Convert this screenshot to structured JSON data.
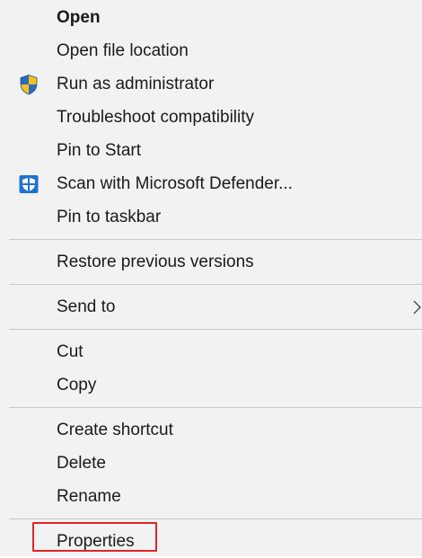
{
  "menu": {
    "group1": [
      {
        "label": "Open",
        "bold": true
      },
      {
        "label": "Open file location"
      },
      {
        "label": "Run as administrator",
        "icon": "shield-uac-icon"
      },
      {
        "label": "Troubleshoot compatibility"
      },
      {
        "label": "Pin to Start"
      },
      {
        "label": "Scan with Microsoft Defender...",
        "icon": "defender-icon"
      },
      {
        "label": "Pin to taskbar"
      }
    ],
    "group2": [
      {
        "label": "Restore previous versions"
      }
    ],
    "group3": [
      {
        "label": "Send to",
        "submenu": true
      }
    ],
    "group4": [
      {
        "label": "Cut"
      },
      {
        "label": "Copy"
      }
    ],
    "group5": [
      {
        "label": "Create shortcut"
      },
      {
        "label": "Delete"
      },
      {
        "label": "Rename"
      }
    ],
    "group6": [
      {
        "label": "Properties",
        "highlighted": true
      }
    ]
  },
  "colors": {
    "background": "#f2f2f2",
    "separator": "#c8c8c8",
    "highlight": "#e02525",
    "uac_blue": "#2b6bc2",
    "uac_yellow": "#f4c21a",
    "defender_blue": "#1e73d2"
  }
}
